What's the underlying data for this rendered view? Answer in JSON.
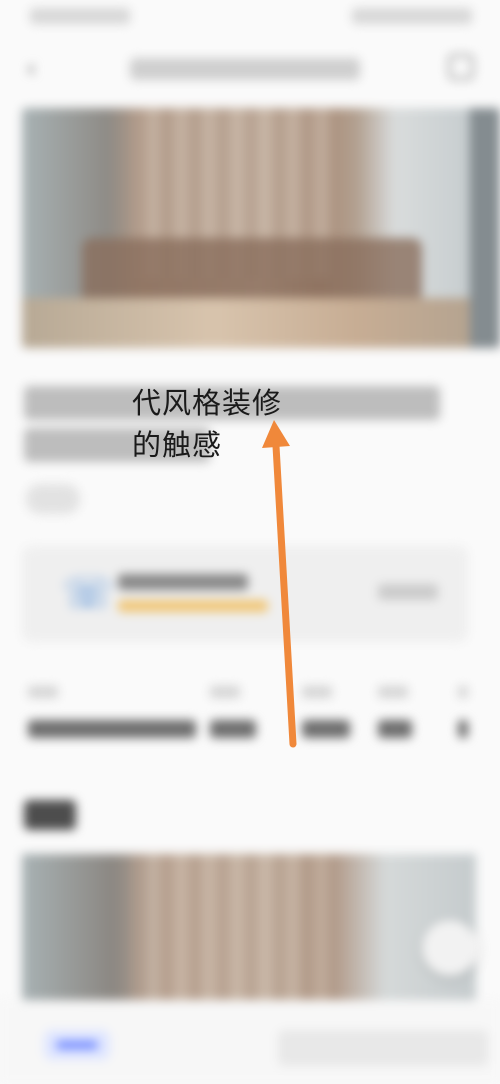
{
  "headline": {
    "line1_visible": "代风格装修",
    "line2_visible": "的触感"
  },
  "annotation": {
    "arrow_color": "#f0883a",
    "arrow_icon": "up-arrow-icon"
  },
  "icons": {
    "back": "‹",
    "share": "share-icon",
    "designer": "phone-icon"
  }
}
